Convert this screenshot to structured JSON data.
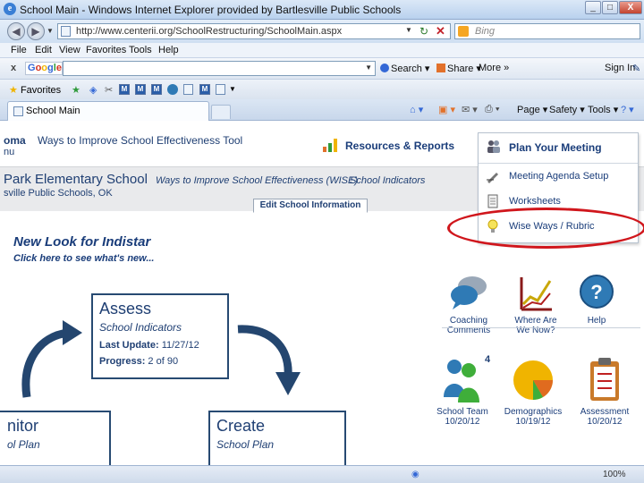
{
  "window": {
    "title": "School Main - Windows Internet Explorer provided by Bartlesville Public Schools",
    "buttons": {
      "min": "_",
      "max": "□",
      "close": "X"
    }
  },
  "address": {
    "url": "http://www.centerii.org/SchoolRestructuring/SchoolMain.aspx",
    "search_placeholder": "Bing"
  },
  "menu": [
    "File",
    "Edit",
    "View",
    "Favorites",
    "Tools",
    "Help"
  ],
  "google_toolbar": {
    "close": "x",
    "logo": "Google",
    "search_label": "Search",
    "share_label": "Share",
    "more_label": "More »",
    "signin_label": "Sign In"
  },
  "favorites": {
    "label": "Favorites",
    "icons": [
      "M",
      "M",
      "M",
      "M"
    ]
  },
  "tabs": {
    "active_label": "School Main",
    "commands": {
      "page": "Page ▾",
      "safety": "Safety ▾",
      "tools": "Tools ▾"
    }
  },
  "site_header": {
    "brand": "oma",
    "tagline": "Ways to Improve School Effectiveness Tool",
    "brand_sub": "nu",
    "resources_link": "Resources & Reports"
  },
  "school": {
    "name": "Park Elementary School",
    "crumb": "Ways to Improve School Effectiveness (WISE)",
    "indicators_link": "School Indicators",
    "district": "sville Public Schools, OK",
    "edit_button": "Edit School Information"
  },
  "plan_menu": {
    "title": "Plan Your Meeting",
    "items": [
      "Meeting Agenda Setup",
      "Worksheets",
      "Wise Ways / Rubric"
    ]
  },
  "main": {
    "headline": "New Look for Indistar",
    "subhead": "Click here to see what's new...",
    "assess": {
      "title": "Assess",
      "subtitle": "School Indicators",
      "last_update_label": "Last Update:",
      "last_update_value": "11/27/12",
      "progress_label": "Progress:",
      "progress_value": "2 of 90"
    },
    "monitor": {
      "title": "nitor",
      "subtitle": "ol Plan"
    },
    "create": {
      "title": "Create",
      "subtitle": "School Plan"
    }
  },
  "tiles": {
    "coaching": [
      "Coaching",
      "Comments"
    ],
    "where": [
      "Where Are",
      "We Now?"
    ],
    "help": [
      "Help"
    ],
    "team": [
      "School Team",
      "10/20/12"
    ],
    "demographics": [
      "Demographics",
      "10/19/12"
    ],
    "assessment": [
      "Assessment",
      "10/20/12"
    ],
    "team_badge": "4"
  },
  "status": {
    "zoom": "100%"
  },
  "colors": {
    "accent_navy": "#1f3f73",
    "annotation_red": "#d0161c",
    "ie_blue": "#3a7fd5"
  }
}
